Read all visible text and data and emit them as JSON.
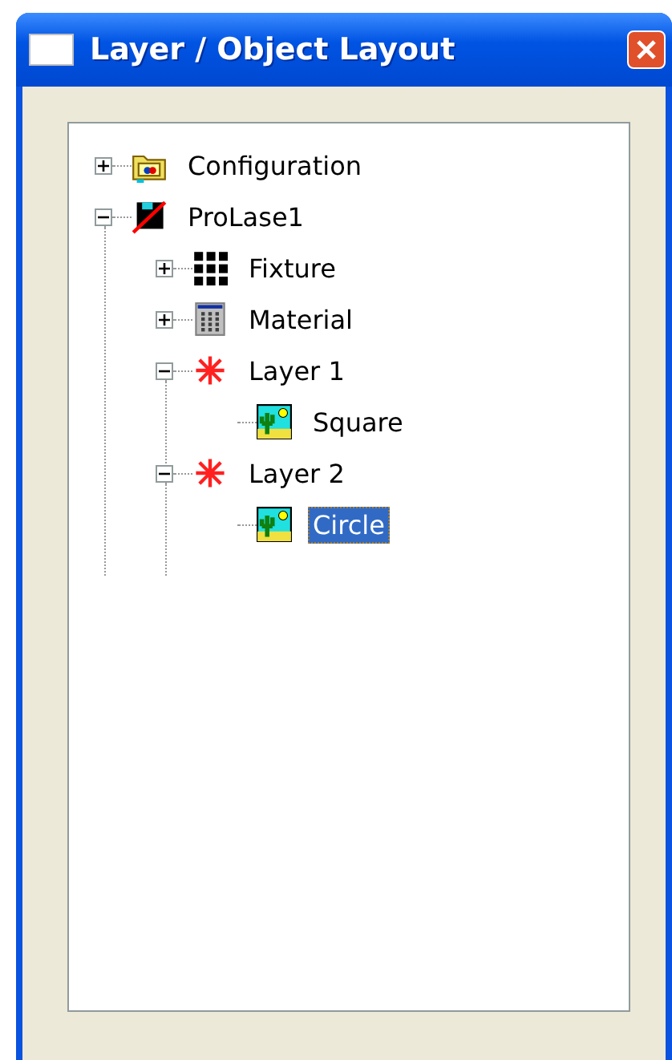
{
  "window": {
    "title": "Layer / Object Layout"
  },
  "tree": {
    "items": [
      {
        "label": "Configuration",
        "kind": "config",
        "expanded": false,
        "selected": false
      },
      {
        "label": "ProLase1",
        "kind": "device",
        "expanded": true,
        "selected": false,
        "children": [
          {
            "label": "Fixture",
            "kind": "fixture",
            "expanded": false,
            "selected": false
          },
          {
            "label": "Material",
            "kind": "material",
            "expanded": false,
            "selected": false
          },
          {
            "label": "Layer 1",
            "kind": "layer",
            "expanded": true,
            "selected": false,
            "children": [
              {
                "label": "Square",
                "kind": "object",
                "selected": false
              }
            ]
          },
          {
            "label": "Layer 2",
            "kind": "layer",
            "expanded": true,
            "selected": false,
            "children": [
              {
                "label": "Circle",
                "kind": "object",
                "selected": true
              }
            ]
          }
        ]
      }
    ]
  }
}
